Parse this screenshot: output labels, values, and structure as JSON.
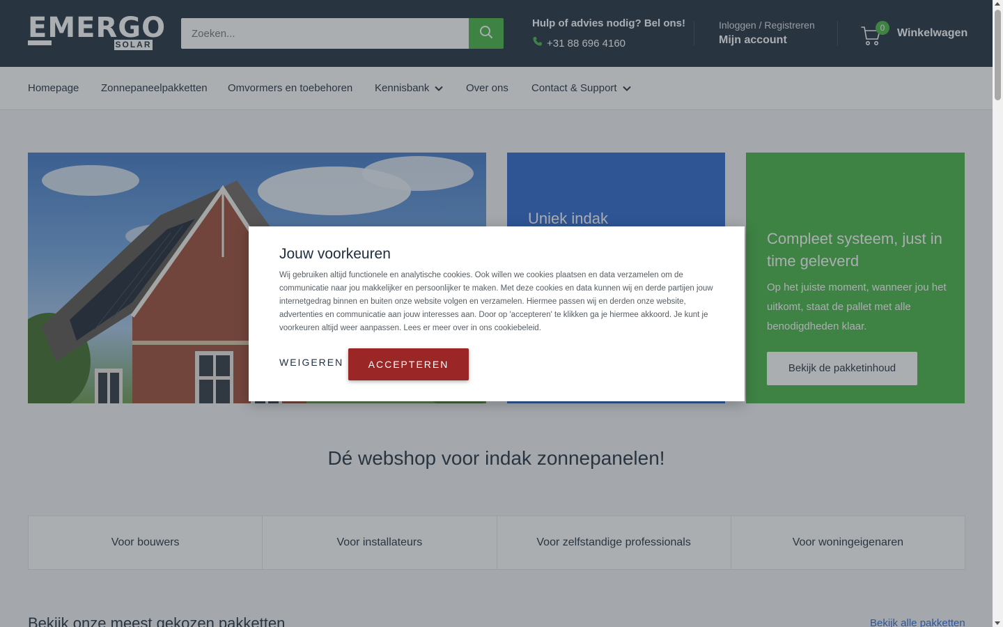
{
  "header": {
    "logo_text": "EMERGO",
    "logo_sub": "SOLAR",
    "search_placeholder": "Zoeken...",
    "help_title": "Hulp of advies nodig? Bel ons!",
    "help_phone": "+31 88 696 4160",
    "account_top": "Inloggen / Registreren",
    "account_main": "Mijn account",
    "cart_count": "0",
    "cart_label": "Winkelwagen",
    "icons": [
      "search-icon",
      "phone-icon",
      "cart-icon"
    ]
  },
  "nav": {
    "items": [
      {
        "label": "Homepage",
        "has_dropdown": false
      },
      {
        "label": "Zonnepaneelpakketten",
        "has_dropdown": false
      },
      {
        "label": "Omvormers en toebehoren",
        "has_dropdown": false
      },
      {
        "label": "Kennisbank",
        "has_dropdown": true
      },
      {
        "label": "Over ons",
        "has_dropdown": false
      },
      {
        "label": "Contact & Support",
        "has_dropdown": true
      }
    ]
  },
  "hero": {
    "blue_title": "Uniek indak",
    "green_title": "Compleet systeem, just in time geleverd",
    "green_text": "Op het juiste moment, wanneer jou het uitkomt, staat de pallet met alle benodigdheden klaar.",
    "green_button": "Bekijk de pakketinhoud"
  },
  "tagline": "Dé webshop voor indak zonnepanelen!",
  "categories": [
    "Voor bouwers",
    "Voor installateurs",
    "Voor zelfstandige professionals",
    "Voor woningeigenaren"
  ],
  "section": {
    "title": "Bekijk onze meest gekozen pakketten",
    "link": "Bekijk alle pakketten"
  },
  "modal": {
    "title": "Jouw voorkeuren",
    "text": "Wij gebruiken altijd functionele en analytische cookies. Ook willen we cookies plaatsen en data verzamelen om de communicatie naar jou makkelijker en persoonlijker te maken. Met deze cookies en data kunnen wij en derde partijen jouw internetgedrag binnen en buiten onze website volgen en verzamelen. Hiermee passen wij en derden onze website, advertenties en communicatie aan jouw interesses aan. Door op 'accepteren' te klikken ga je hiermee akkoord. Je kunt je voorkeuren altijd weer aanpassen. Lees er meer over in ons cookiebeleid.",
    "decline_label": "WEIGEREN",
    "accept_label": "ACCEPTEREN"
  },
  "colors": {
    "header_bg": "#1e2d3d",
    "accent_green": "#44b444",
    "promo_blue": "#2a66cf",
    "accept_red": "#9a2626"
  }
}
